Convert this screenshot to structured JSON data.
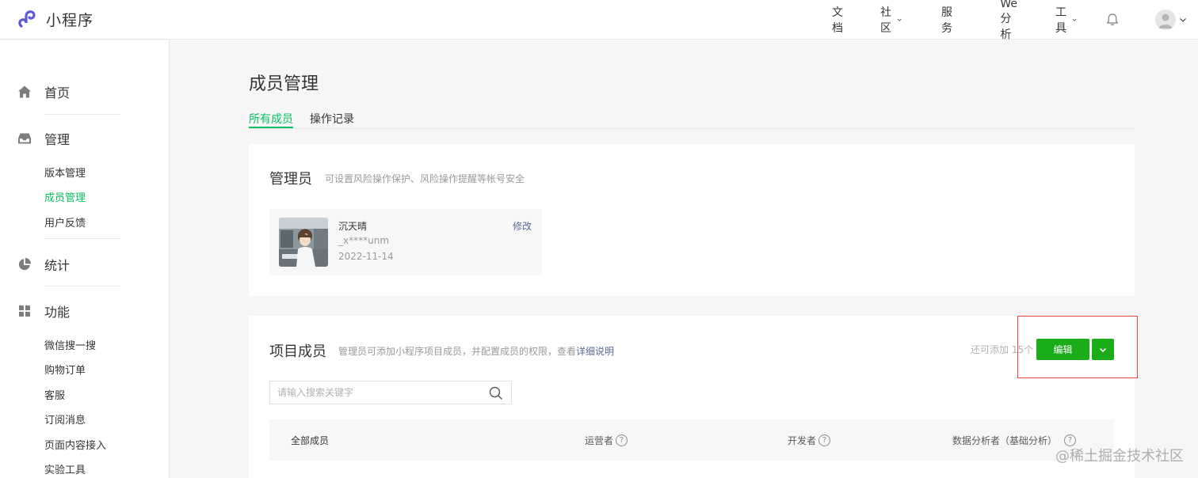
{
  "app": {
    "logo_text": "小程序",
    "brand_color": "#5b5bd6",
    "accent_color": "#07c160",
    "button_color": "#1aad19",
    "link_color": "#576b95"
  },
  "topnav": {
    "docs": "文档",
    "community": "社区",
    "services": "服务",
    "analytics": "We分析",
    "tools": "工具"
  },
  "sidebar": {
    "home": "首页",
    "manage": {
      "title": "管理",
      "items": [
        "版本管理",
        "成员管理",
        "用户反馈"
      ],
      "active": "成员管理"
    },
    "stats": "统计",
    "features": {
      "title": "功能",
      "items": [
        "微信搜一搜",
        "购物订单",
        "客服",
        "订阅消息",
        "页面内容接入",
        "实验工具"
      ]
    }
  },
  "page": {
    "title": "成员管理",
    "tabs": [
      "所有成员",
      "操作记录"
    ],
    "active_tab": "所有成员"
  },
  "admin_card": {
    "title": "管理员",
    "desc": "可设置风险操作保护、风险操作提醒等帐号安全",
    "admin": {
      "name": "沉天晴",
      "id": "_x****unm",
      "date": "2022-11-14",
      "edit_label": "修改"
    }
  },
  "members_card": {
    "title": "项目成员",
    "desc_prefix": "管理员可添加小程序项目成员，并配置成员的权限，查看",
    "desc_link": "详细说明",
    "remaining": "还可添加 15个",
    "edit_button": "编辑",
    "search_placeholder": "请输入搜索关键字",
    "columns": [
      "全部成员",
      "运营者",
      "开发者",
      "数据分析者（基础分析）"
    ],
    "help_glyph": "?"
  },
  "watermark": "@稀土掘金技术社区"
}
